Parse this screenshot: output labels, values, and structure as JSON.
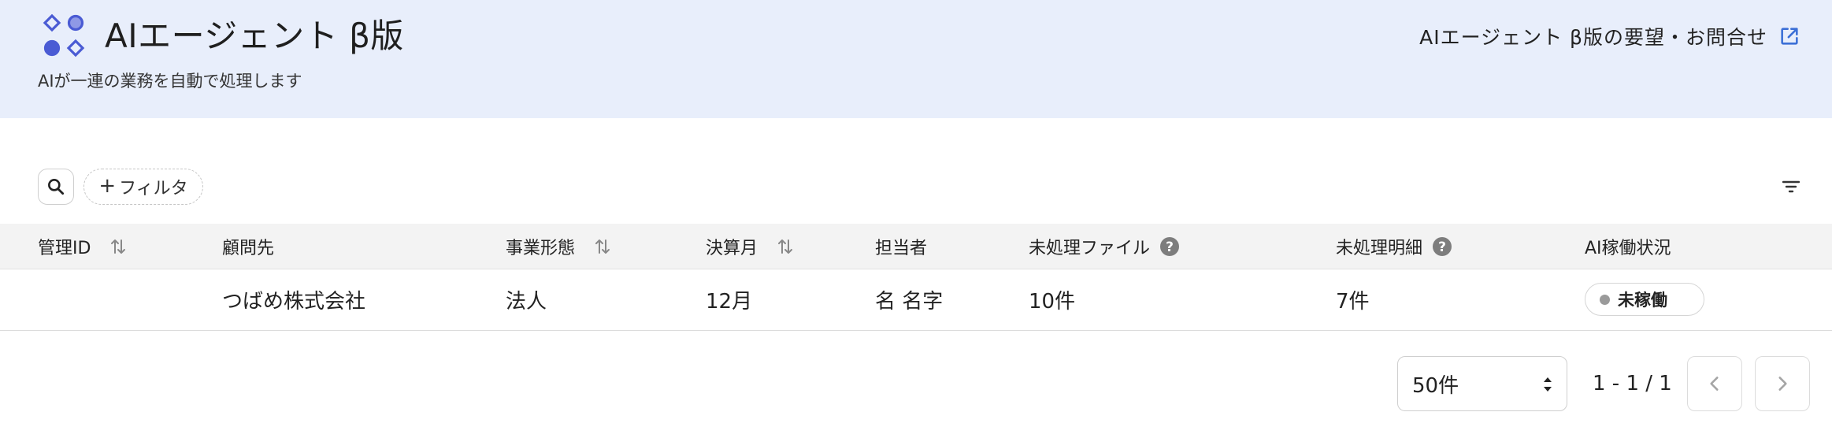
{
  "app": {
    "title": "AIエージェント β版",
    "subtitle": "AIが一連の業務を自動で処理します",
    "feedback_link": "AIエージェント β版の要望・お問合せ",
    "accent_color": "#4a5bd4",
    "header_bg": "#e8eefb"
  },
  "toolbar": {
    "search_icon": "search-icon",
    "filter_label": "フィルタ",
    "filter_plus": "+",
    "sort_menu_icon": "filter-list-icon"
  },
  "table": {
    "columns": [
      {
        "label": "管理ID",
        "sortable": true,
        "help": false
      },
      {
        "label": "顧問先",
        "sortable": false,
        "help": false
      },
      {
        "label": "事業形態",
        "sortable": true,
        "help": false
      },
      {
        "label": "決算月",
        "sortable": true,
        "help": false
      },
      {
        "label": "担当者",
        "sortable": false,
        "help": false
      },
      {
        "label": "未処理ファイル",
        "sortable": false,
        "help": true
      },
      {
        "label": "未処理明細",
        "sortable": false,
        "help": true
      },
      {
        "label": "AI稼働状況",
        "sortable": false,
        "help": false
      }
    ],
    "rows": [
      {
        "id": "",
        "client": "つばめ株式会社",
        "business_type": "法人",
        "closing_month": "12月",
        "assignee": "名 名字",
        "unprocessed_files": "10件",
        "unprocessed_items": "7件",
        "ai_status": "未稼働",
        "ai_status_color": "#9a9a9a"
      }
    ]
  },
  "pagination": {
    "page_size": "50件",
    "range": "1 - 1 / 1"
  }
}
